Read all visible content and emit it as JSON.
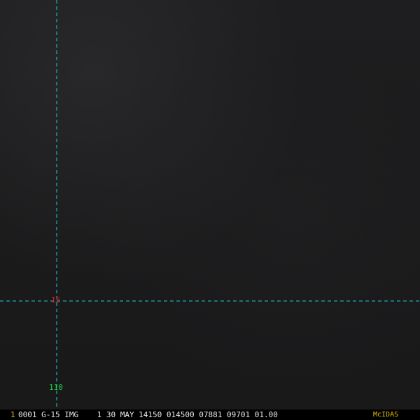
{
  "colors": {
    "grid_line": "#22c9d8",
    "latitude_label": "#e02020",
    "longitude_label": "#20d040",
    "status_text": "#e8e8e8",
    "frame_number": "#e0c000",
    "brand": "#e0c000"
  },
  "grid": {
    "latitude_label": "15",
    "longitude_label": "110"
  },
  "status_bar": {
    "frame_number": "1",
    "info": "0001 G-15 IMG    1 30 MAY 14150 014500 07881 09701 01.00",
    "brand": "McIDAS"
  }
}
